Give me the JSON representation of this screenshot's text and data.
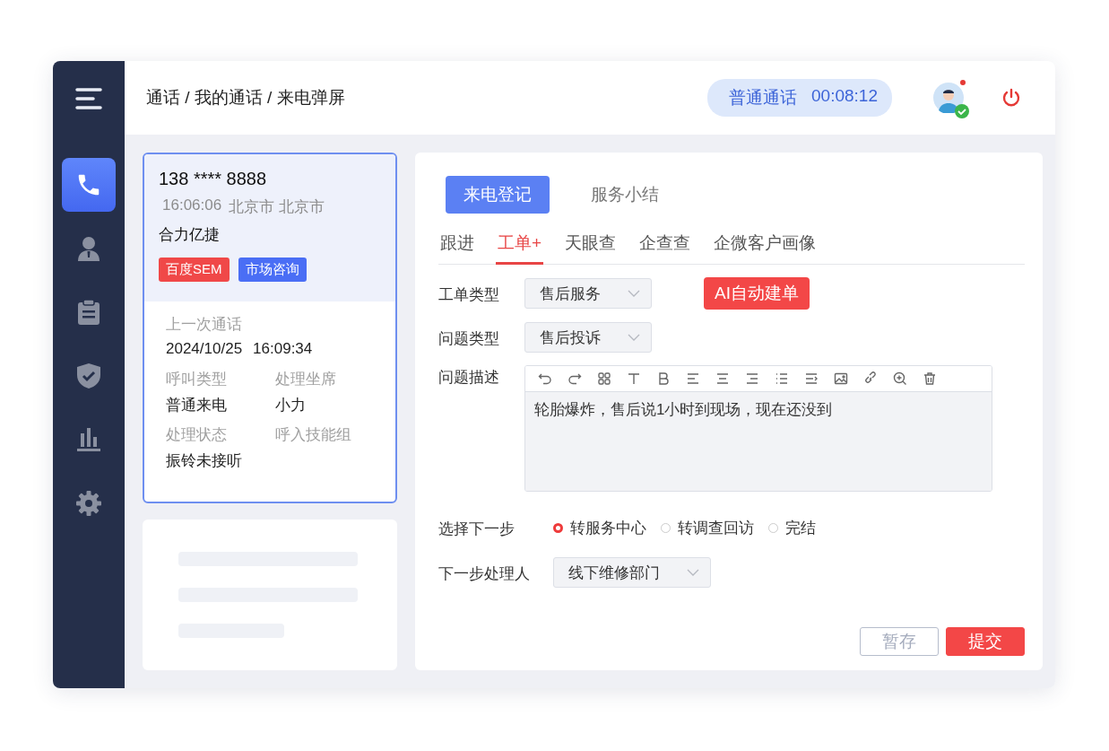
{
  "sidebar": {
    "items": [
      {
        "kind": "phone",
        "selected": true
      },
      {
        "kind": "person",
        "selected": false
      },
      {
        "kind": "clipboard",
        "selected": false
      },
      {
        "kind": "shield",
        "selected": false
      },
      {
        "kind": "chart",
        "selected": false
      },
      {
        "kind": "gear",
        "selected": false
      }
    ]
  },
  "header": {
    "breadcrumb": "通话 / 我的通话 / 来电弹屏",
    "call_type": "普通通话",
    "call_timer": "00:08:12",
    "avatar": {
      "unread": true,
      "online": true
    }
  },
  "caller_card": {
    "phone": "138 **** 8888",
    "time": "16:06:06",
    "location": "北京市 北京市",
    "company": "合力亿捷",
    "tags": [
      {
        "label": "百度SEM",
        "color": "#f04848"
      },
      {
        "label": "市场咨询",
        "color": "#4a6ef5"
      }
    ],
    "last_call_label": "上一次通话",
    "last_call_date": "2024/10/25",
    "last_call_time": "16:09:34",
    "fields": [
      {
        "label": "呼叫类型",
        "value": "普通来电"
      },
      {
        "label": "处理坐席",
        "value": "小力"
      },
      {
        "label": "处理状态",
        "value": "振铃未接听"
      },
      {
        "label": "呼入技能组"
      }
    ]
  },
  "main_tabs": [
    {
      "label": "来电登记",
      "selected": true
    },
    {
      "label": "服务小结",
      "selected": false
    }
  ],
  "sub_tabs": [
    {
      "label": "跟进",
      "selected": false
    },
    {
      "label": "工单+",
      "selected": true
    },
    {
      "label": "天眼查",
      "selected": false
    },
    {
      "label": "企查查",
      "selected": false
    },
    {
      "label": "企微客户画像",
      "selected": false
    }
  ],
  "form": {
    "ticket_type": {
      "label": "工单类型",
      "value": "售后服务"
    },
    "ai_button": "AI自动建单",
    "issue_type": {
      "label": "问题类型",
      "value": "售后投诉"
    },
    "description": {
      "label": "问题描述",
      "toolbar": [
        {
          "kind": "undo"
        },
        {
          "kind": "redo"
        },
        {
          "kind": "grid"
        },
        {
          "kind": "text"
        },
        {
          "kind": "bold"
        },
        {
          "kind": "align-left"
        },
        {
          "kind": "align-center"
        },
        {
          "kind": "align-right"
        },
        {
          "kind": "list"
        },
        {
          "kind": "indent"
        },
        {
          "kind": "image"
        },
        {
          "kind": "link"
        },
        {
          "kind": "zoom-in"
        },
        {
          "kind": "trash"
        }
      ],
      "value": "轮胎爆炸，售后说1小时到现场，现在还没到"
    },
    "next_step": {
      "label": "选择下一步",
      "options": [
        {
          "label": "转服务中心",
          "selected": true
        },
        {
          "label": "转调查回访",
          "selected": false
        },
        {
          "label": "完结",
          "selected": false
        }
      ]
    },
    "handler": {
      "label": "下一步处理人",
      "value": "线下维修部门"
    }
  },
  "buttons": [
    {
      "label": "暂存",
      "kind": "secondary"
    },
    {
      "label": "提交",
      "kind": "primary"
    }
  ]
}
